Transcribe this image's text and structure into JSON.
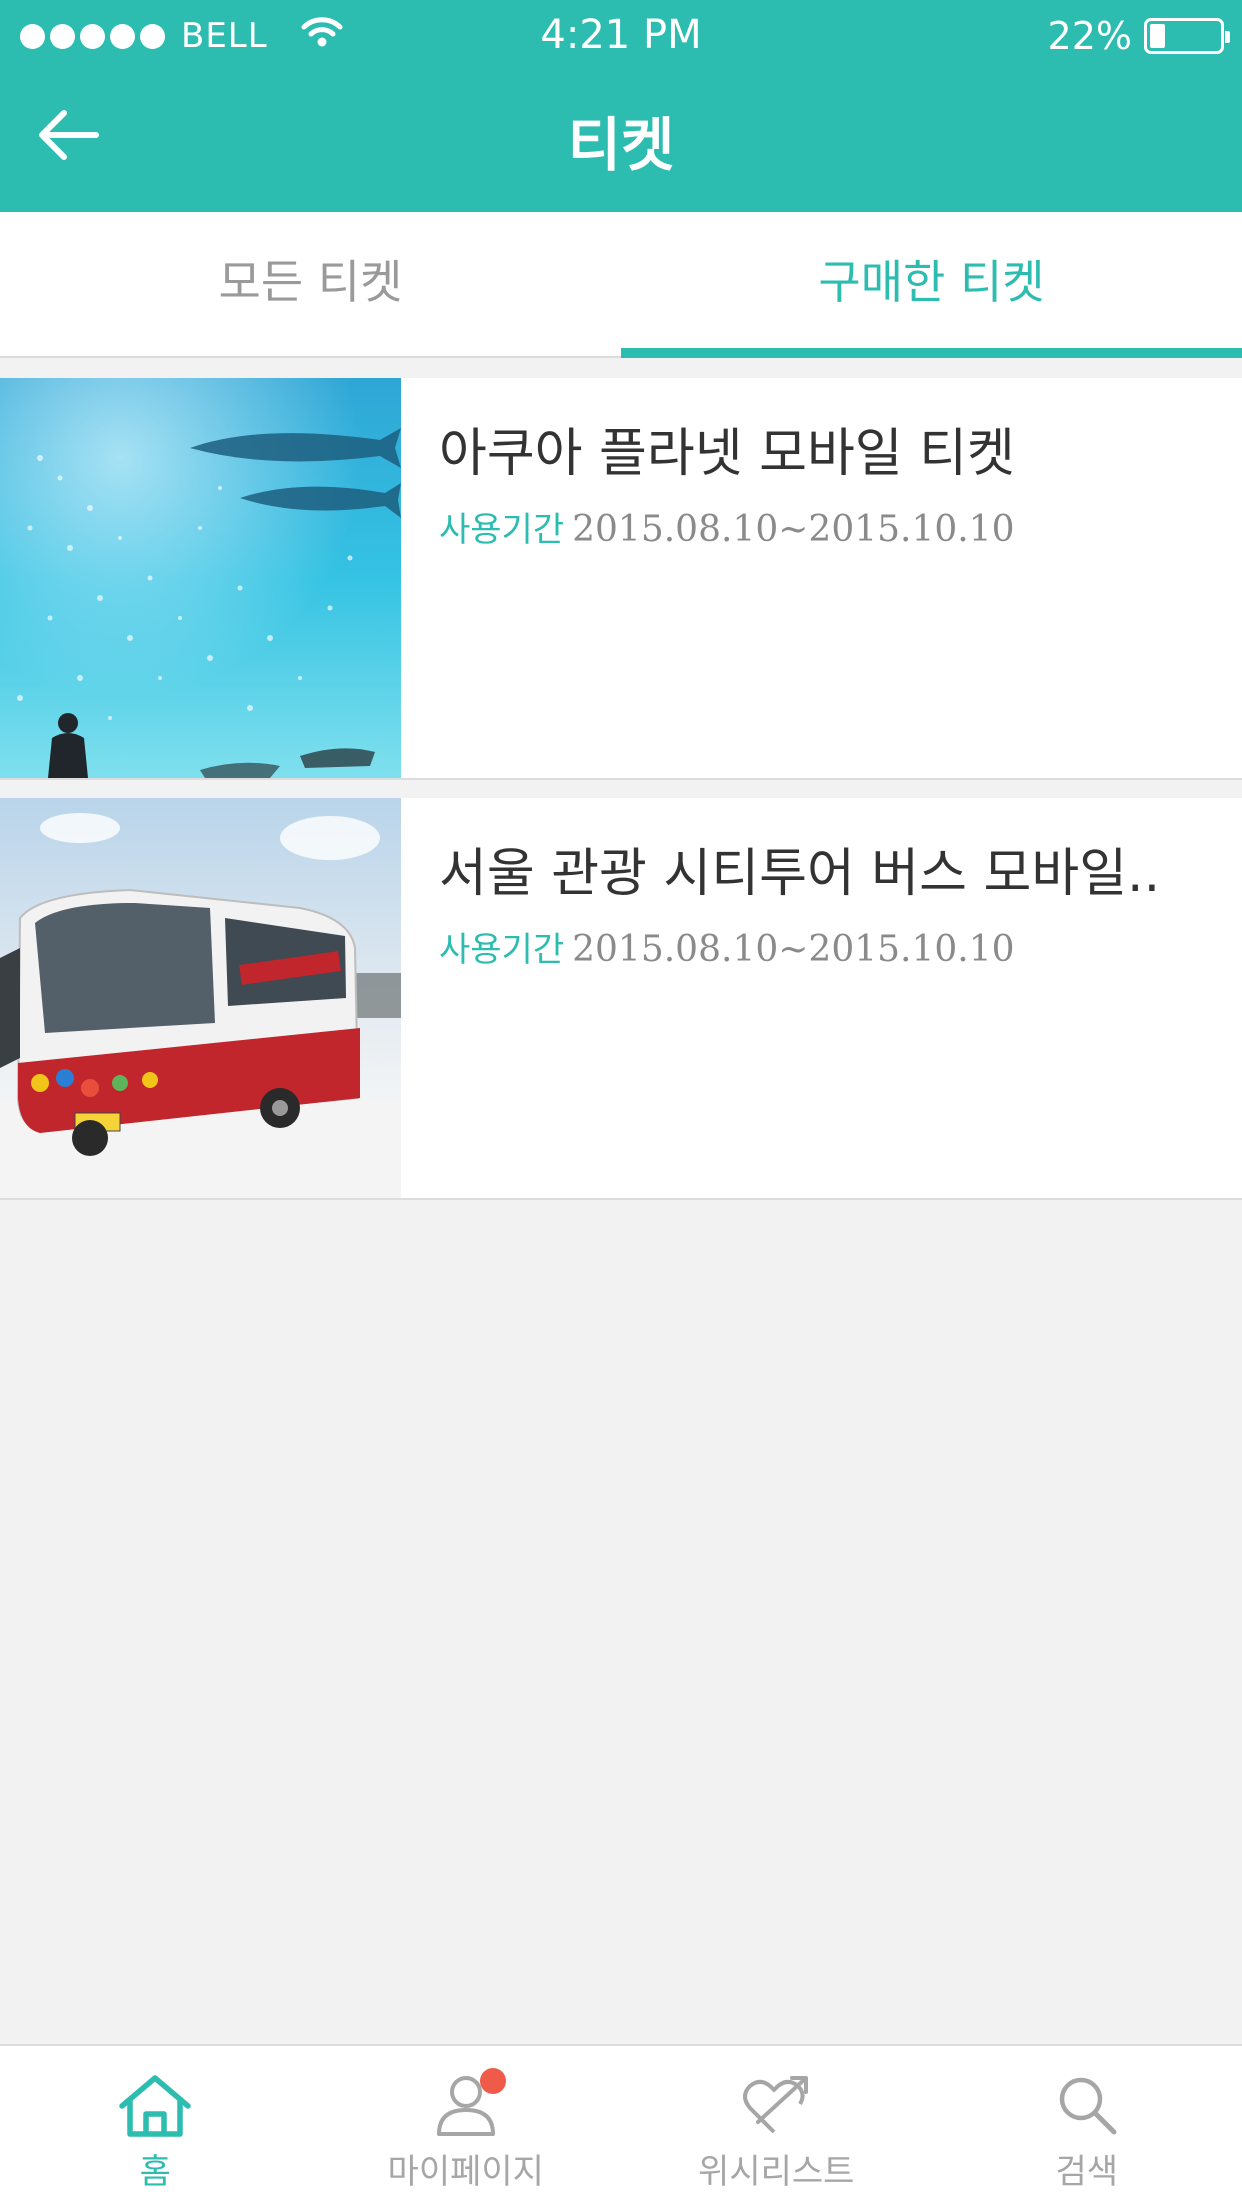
{
  "status_bar": {
    "carrier": "BELL",
    "time": "4:21 PM",
    "battery_percent": "22%",
    "battery_level": 0.22,
    "signal_dots": 5
  },
  "header": {
    "title": "티켓",
    "back_icon": "arrow-left-icon"
  },
  "tabs": [
    {
      "label": "모든 티켓",
      "active": false
    },
    {
      "label": "구매한 티켓",
      "active": true
    }
  ],
  "tickets": [
    {
      "title": "아쿠아 플라넷 모바일 티켓",
      "period_label": "사용기간",
      "period_value": "2015.08.10~2015.10.10",
      "image": "aquarium-photo"
    },
    {
      "title": "서울 관광 시티투어 버스 모바일..",
      "period_label": "사용기간",
      "period_value": "2015.08.10~2015.10.10",
      "image": "city-tour-bus-photo"
    }
  ],
  "bottom_nav": [
    {
      "label": "홈",
      "icon": "home-icon",
      "active": true
    },
    {
      "label": "마이페이지",
      "icon": "user-icon",
      "active": false,
      "badge": true
    },
    {
      "label": "위시리스트",
      "icon": "heart-arrow-icon",
      "active": false
    },
    {
      "label": "검색",
      "icon": "search-icon",
      "active": false
    }
  ],
  "colors": {
    "accent": "#2dbcb0",
    "badge": "#f05a48",
    "background": "#f2f2f2"
  }
}
